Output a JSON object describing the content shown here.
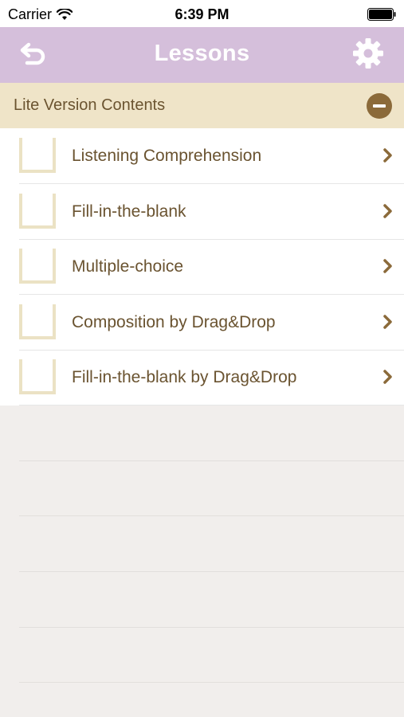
{
  "status_bar": {
    "carrier": "Carrier",
    "time": "6:39 PM"
  },
  "nav": {
    "title": "Lessons",
    "back_icon": "back-arrow-icon",
    "settings_icon": "gear-icon"
  },
  "section": {
    "title": "Lite Version Contents",
    "collapse_icon": "minus-circle-icon"
  },
  "items": [
    {
      "label": "Listening Comprehension"
    },
    {
      "label": "Fill-in-the-blank"
    },
    {
      "label": "Multiple-choice"
    },
    {
      "label": "Composition by Drag&Drop"
    },
    {
      "label": "Fill-in-the-blank by Drag&Drop"
    }
  ],
  "colors": {
    "nav_background": "#d5bfdb",
    "section_background": "#efe4c8",
    "accent_brown": "#8b6a3a",
    "text_brown": "#6a5330"
  }
}
